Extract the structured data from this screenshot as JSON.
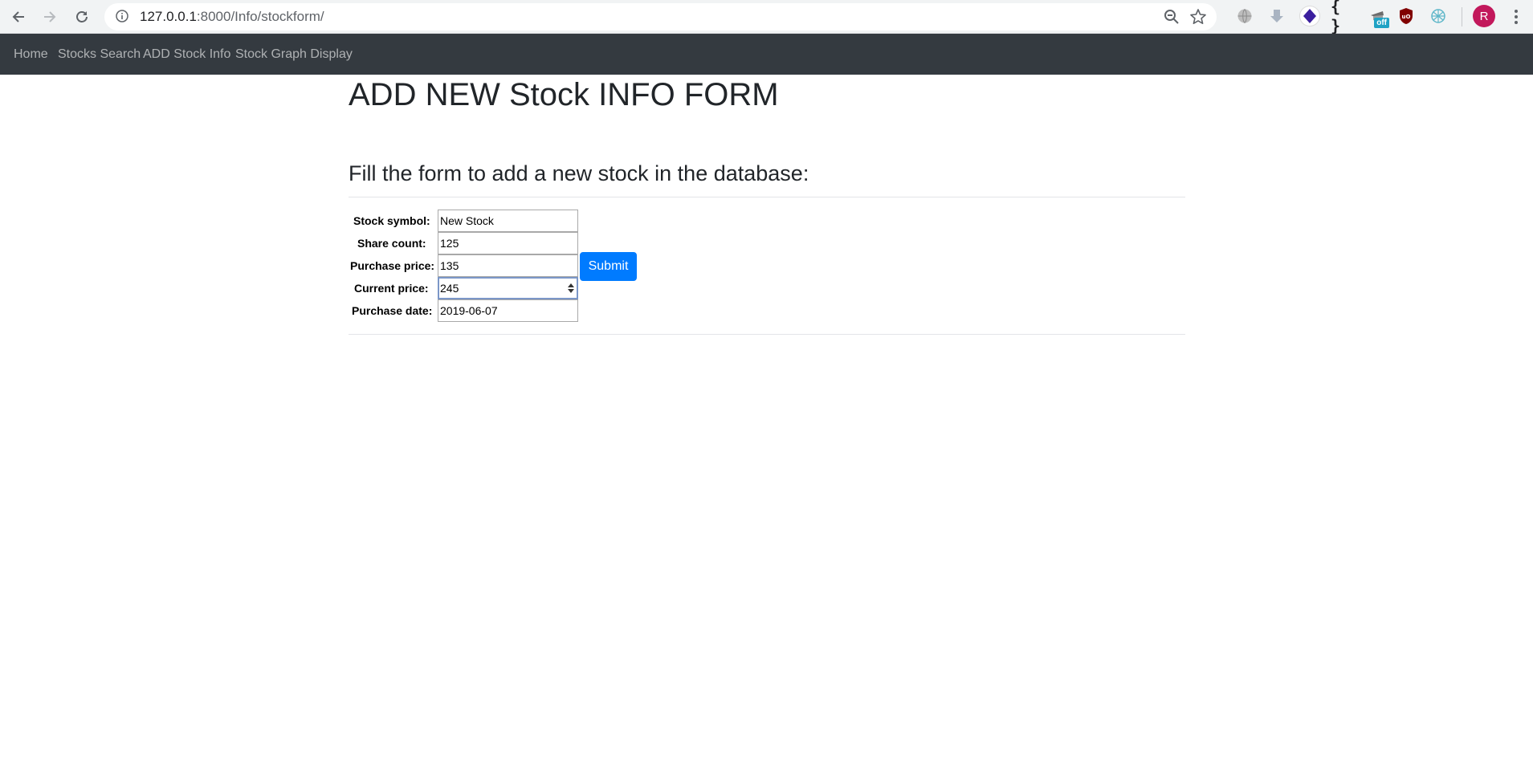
{
  "browser": {
    "url_host": "127.0.0.1",
    "url_rest": ":8000/Info/stockform/",
    "profile_initial": "R",
    "extension_braces": "{ }",
    "extension_badge": "off"
  },
  "navbar": {
    "items": [
      {
        "label": "Home"
      },
      {
        "label": "Stocks Search"
      },
      {
        "label": "ADD Stock Info"
      },
      {
        "label": "Stock Graph Display"
      }
    ]
  },
  "page": {
    "title": "ADD NEW Stock INFO FORM",
    "subtitle": "Fill the form to add a new stock in the database:"
  },
  "form": {
    "fields": [
      {
        "label": "Stock symbol:",
        "value": "New Stock"
      },
      {
        "label": "Share count:",
        "value": "125"
      },
      {
        "label": "Purchase price:",
        "value": "135"
      },
      {
        "label": "Current price:",
        "value": "245"
      },
      {
        "label": "Purchase date:",
        "value": "2019-06-07"
      }
    ],
    "submit_label": "Submit"
  },
  "colors": {
    "navbar_bg": "#343a40",
    "primary_button": "#007bff",
    "avatar": "#c2185b"
  }
}
